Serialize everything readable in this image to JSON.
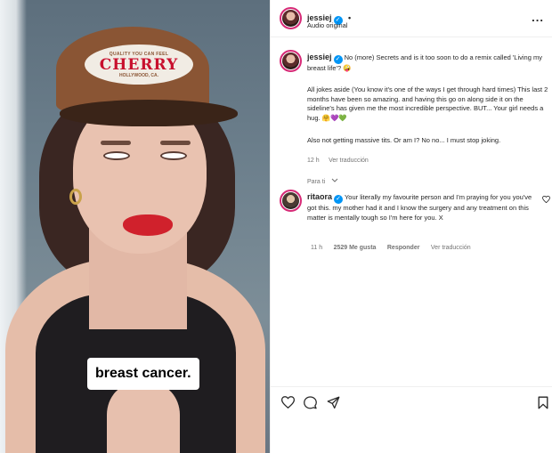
{
  "video": {
    "caption": "breast cancer.",
    "cap_small_top": "QUALITY YOU CAN FEEL",
    "cap_brand": "CHERRY",
    "cap_small_bottom": "HOLLYWOOD, CA."
  },
  "header": {
    "username": "jessiej",
    "dot": "•",
    "audio": "Audio original",
    "more": "..."
  },
  "post": {
    "username": "jessiej",
    "p1": "No (more) Secrets and is it too soon to do a remix called 'Living my breast life'? 🤪",
    "p2": "All jokes aside (You know it's one of the ways I get through hard times) This last 2 months have been so amazing. and having this go on along side it on the sideline's has given me the most incredible perspective. BUT... Your girl needs a hug. 🤗💜💚",
    "p3": "Also not getting massive tits. Or am I? No no... I must stop joking.",
    "time": "12 h",
    "translate": "Ver traducción"
  },
  "sort": {
    "label": "Para ti"
  },
  "comment": {
    "username": "ritaora",
    "text": "Your literally my favourite person and I'm praying for you you've got this. my mother had it and I know the surgery and any treatment on this matter is mentally tough so I'm here for you. X",
    "time": "11 h",
    "likes": "2529 Me gusta",
    "reply": "Responder",
    "translate": "Ver traducción"
  }
}
